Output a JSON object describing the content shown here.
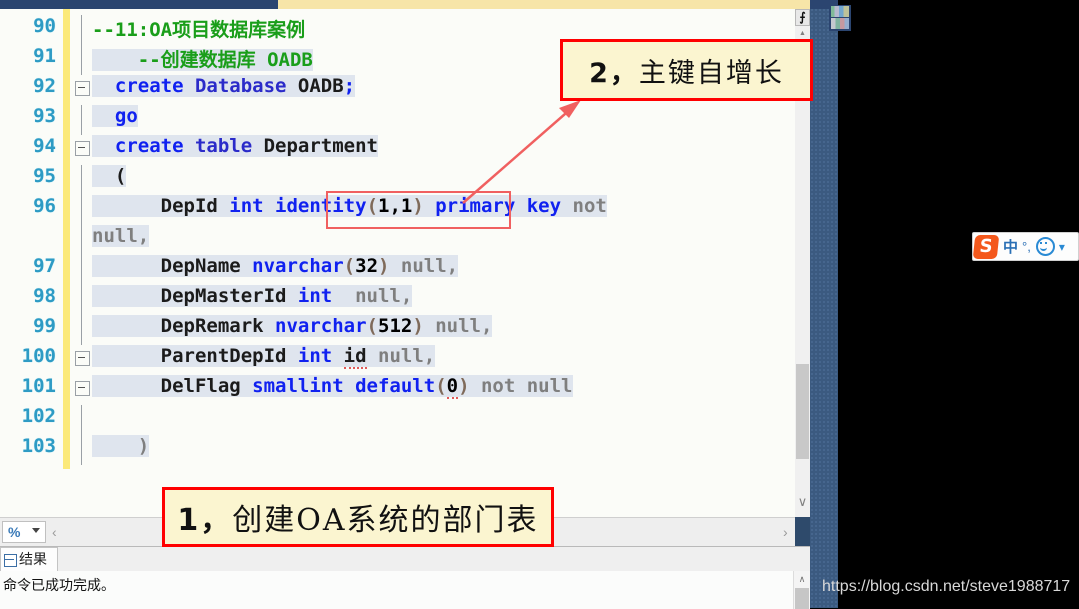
{
  "editor": {
    "first_line": 90,
    "lines": [
      {
        "n": 90,
        "fold": "start-open",
        "tokens": [
          {
            "t": "--11:OA项目数据库案例",
            "c": "cmt"
          }
        ]
      },
      {
        "n": 91,
        "fold": "bar",
        "tokens": [
          {
            "t": "    --创建数据库 OADB",
            "c": "cmt"
          }
        ]
      },
      {
        "n": 92,
        "fold": "box",
        "tokens": [
          {
            "t": "  create ",
            "c": "kw"
          },
          {
            "t": "Database ",
            "c": "kwv"
          },
          {
            "t": "OADB",
            "c": "id"
          },
          {
            "t": ";",
            "c": "kw"
          }
        ]
      },
      {
        "n": 93,
        "fold": "bar",
        "tokens": [
          {
            "t": "  go",
            "c": "kw"
          }
        ]
      },
      {
        "n": 94,
        "fold": "box",
        "tokens": [
          {
            "t": "  create ",
            "c": "kw"
          },
          {
            "t": "table ",
            "c": "kwv"
          },
          {
            "t": "Department",
            "c": "id"
          }
        ]
      },
      {
        "n": 95,
        "fold": "bar",
        "tokens": [
          {
            "t": "  (",
            "c": "id"
          }
        ]
      },
      {
        "n": 96,
        "fold": "bar",
        "tokens": [
          {
            "t": "      DepId ",
            "c": "id"
          },
          {
            "t": "int ",
            "c": "kw"
          },
          {
            "t": "identity",
            "c": "kw"
          },
          {
            "t": "(",
            "c": "punct"
          },
          {
            "t": "1,1",
            "c": "num"
          },
          {
            "t": ") ",
            "c": "punct"
          },
          {
            "t": "primary key ",
            "c": "kw"
          },
          {
            "t": "not",
            "c": "gray"
          }
        ]
      },
      {
        "n": "",
        "fold": "bar",
        "tokens": [
          {
            "t": "null,",
            "c": "gray"
          }
        ],
        "wrap": true
      },
      {
        "n": 97,
        "fold": "bar",
        "tokens": [
          {
            "t": "      DepName ",
            "c": "id"
          },
          {
            "t": "nvarchar",
            "c": "kw"
          },
          {
            "t": "(",
            "c": "punct"
          },
          {
            "t": "32",
            "c": "num"
          },
          {
            "t": ") ",
            "c": "punct"
          },
          {
            "t": "null,",
            "c": "gray"
          }
        ]
      },
      {
        "n": 98,
        "fold": "bar",
        "tokens": [
          {
            "t": "      DepMasterId ",
            "c": "id"
          },
          {
            "t": "int",
            "c": "kw"
          },
          {
            "t": "  null,",
            "c": "gray"
          }
        ]
      },
      {
        "n": 99,
        "fold": "bar",
        "tokens": [
          {
            "t": "      DepRemark ",
            "c": "id"
          },
          {
            "t": "nvarchar",
            "c": "kw"
          },
          {
            "t": "(",
            "c": "punct"
          },
          {
            "t": "512",
            "c": "num"
          },
          {
            "t": ") ",
            "c": "punct"
          },
          {
            "t": "null,",
            "c": "gray"
          }
        ]
      },
      {
        "n": 100,
        "fold": "box",
        "tokens": [
          {
            "t": "      ParentDepId ",
            "c": "id"
          },
          {
            "t": "int ",
            "c": "kw"
          },
          {
            "t": "id",
            "c": "id squig"
          },
          {
            "t": " null,",
            "c": "gray"
          }
        ]
      },
      {
        "n": 101,
        "fold": "box",
        "tokens": [
          {
            "t": "      DelFlag ",
            "c": "id"
          },
          {
            "t": "smallint ",
            "c": "kw"
          },
          {
            "t": "default",
            "c": "kw"
          },
          {
            "t": "(",
            "c": "punct"
          },
          {
            "t": "0",
            "c": "num squig"
          },
          {
            "t": ") ",
            "c": "punct"
          },
          {
            "t": "not null",
            "c": "gray"
          }
        ]
      },
      {
        "n": 102,
        "fold": "bar",
        "tokens": []
      },
      {
        "n": 103,
        "fold": "bar",
        "tokens": [
          {
            "t": "    )",
            "c": "gray"
          }
        ]
      }
    ]
  },
  "zoombar": {
    "zoom_value": "%",
    "left_arrow": "‹"
  },
  "splitter": {
    "icon_label": "⨍"
  },
  "scrollbar": {
    "up_arrow": "▲",
    "down_arrow": "∨"
  },
  "results": {
    "tab_label": "结果",
    "message": "命令已成功完成。",
    "scroll_up": "∧"
  },
  "annotations": {
    "callout_1": {
      "lead": "1，",
      "text": "创建OA系统的部门表"
    },
    "callout_2": {
      "lead": "2，",
      "text": "主键自增长"
    }
  },
  "ime": {
    "logo_letter": "S",
    "mode_label": "中",
    "punct_label": "°,",
    "more_label": "▾"
  },
  "watermark": {
    "url": "https://blog.csdn.net/steve1988717"
  },
  "colors": {
    "accent_red": "#ff0000",
    "callout_bg": "#fbf5d0",
    "keyword_blue": "#1021f0",
    "comment_green": "#1a9e1a",
    "linenum_cyan": "#2e9bc4",
    "selection": "#dfe5ee",
    "desktop_blue": "#2e4a6b"
  }
}
